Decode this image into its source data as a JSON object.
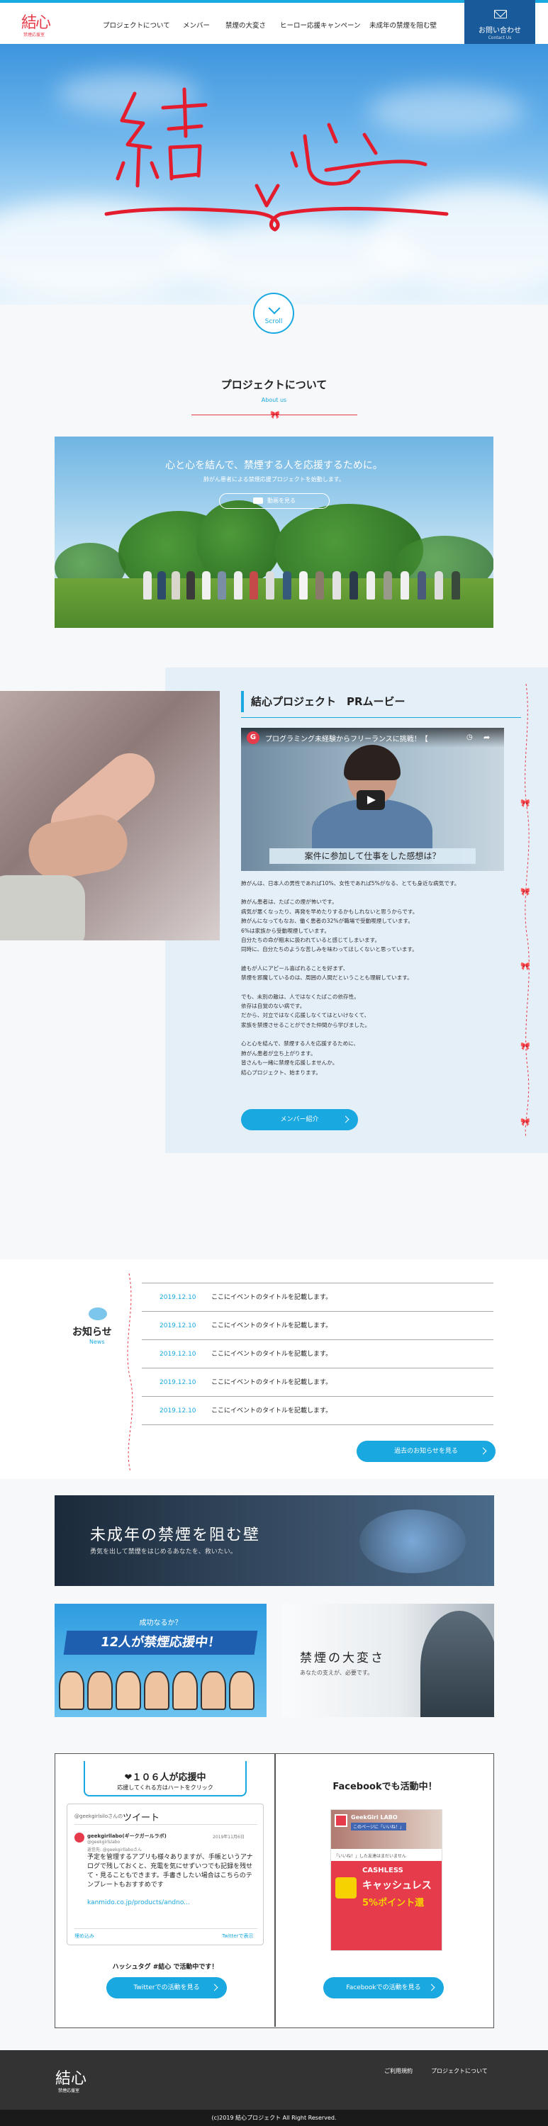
{
  "header": {
    "logo_text": "結心",
    "logo_sub": "禁煙応援室",
    "nav": [
      "プロジェクトについて",
      "メンバー",
      "禁煙の大変さ",
      "ヒーロー応援キャンペーン",
      "未成年の禁煙を阻む壁"
    ],
    "contact_label": "お問い合わせ",
    "contact_sub": "Contact Us"
  },
  "hero": {
    "title": "結心",
    "scroll_label": "Scroll"
  },
  "about": {
    "title": "プロジェクトについて",
    "subtitle": "About us",
    "banner_main": "心と心を結んで、禁煙する人を応援するために。",
    "banner_sub": "肺がん患者による禁煙応援プロジェクトを始動します。",
    "banner_button": "動画を見る"
  },
  "pr": {
    "title": "結心プロジェクト　PRムービー",
    "video_title": "プログラミング未経験からフリーランスに挑戦！【",
    "video_caption": "案件に参加して仕事をした感想は？",
    "paragraphs": [
      [
        "肺がんは、日本人の男性であれば10%、女性であれば5%がなる、とても身近な病気です。"
      ],
      [
        "肺がん患者は、たばこの煙が怖いです。",
        "病気が悪くなったり、再発を早めたりするかもしれないと思うからです。",
        "肺がんになってもなお、働く患者の32%が職場で受動喫煙しています。",
        "6%は家族から受動喫煙しています。",
        "自分たちの命が粗末に扱われていると感じてしまいます。",
        "同時に、自分たちのような苦しみを味わってほしくないと思っています。"
      ],
      [
        "誰もが人にアピール喜ばれることを好まず、",
        "禁煙を邪魔しているのは、周囲の人間だということも理解しています。"
      ],
      [
        "でも、未別の敵は、人ではなくたばこの依存性。",
        "依存は自覚のない病です。",
        "だから、対立ではなく応援しなくてはといけなくて、",
        "家族を禁煙させることができた仲間から学びました。"
      ],
      [
        "心と心を結んで、禁煙する人を応援するために、",
        "肺がん患者が立ち上がります。",
        "皆さんも一緒に禁煙を応援しませんか。",
        "結心プロジェクト、始まります。"
      ]
    ],
    "member_button": "メンバー紹介"
  },
  "news": {
    "title": "お知らせ",
    "subtitle": "News",
    "items": [
      {
        "date": "2019.12.10",
        "title": "ここにイベントのタイトルを記載します。"
      },
      {
        "date": "2019.12.10",
        "title": "ここにイベントのタイトルを記載します。"
      },
      {
        "date": "2019.12.10",
        "title": "ここにイベントのタイトルを記載します。"
      },
      {
        "date": "2019.12.10",
        "title": "ここにイベントのタイトルを記載します。"
      },
      {
        "date": "2019.12.10",
        "title": "ここにイベントのタイトルを記載します。"
      }
    ],
    "more_button": "過去のお知らせを見る"
  },
  "banners": {
    "minor_title": "未成年の禁煙を阻む壁",
    "minor_sub": "勇気を出して禁煙をはじめるあなたを、救いたい。",
    "hero_question": "成功なるか？",
    "hero_main": "12人が禁煙応援中！",
    "difficulty_title": "禁煙の大変さ",
    "difficulty_sub": "あなたの支えが、必要です。"
  },
  "social": {
    "twitter_count": "❤１０６人が応援中",
    "twitter_sub": "応援してくれる方はハートをクリック",
    "tweet_by": "@geekgirlsiloさんの",
    "tweet_label": "ツイート",
    "tweet_date": "2019年11月6日",
    "tweet_account": "geekgirllabo(ギークガールラボ)",
    "tweet_handle": "@geekgirlslabo",
    "tweet_reply": "返信先: @geekgirllaboさん",
    "tweet_body": "予定を管理するアプリも様々ありますが、手帳というアナログで残しておくと、充電を気にせずいつでも記録を残せて・見ることもできます。手書きしたい場合はこちらのテンプレートもおすすめです",
    "tweet_link": "kanmido.co.jp/products/andno...",
    "tweet_embed": "埋め込み",
    "tweet_view": "Twitterで表示",
    "hashtag": "ハッシュタグ #結心 で活動中です！",
    "twitter_button": "Twitterでの活動を見る",
    "facebook_title": "Facebookでも活動中！",
    "fb_page": "GeekGirl LABO",
    "fb_like": "このページに「いいね！」",
    "fb_first": "「いいね！」した友達はまだいません",
    "fb_banner1": "CASHLESS",
    "fb_banner2": "キャッシュレス",
    "fb_banner3": "5%ポイント還",
    "facebook_button": "Facebookでの活動を見る"
  },
  "footer": {
    "logo_text": "結心",
    "logo_sub": "禁煙応援室",
    "links": [
      "ご利用規約",
      "プロジェクトについて"
    ],
    "copyright": "(c)2019 結心プロジェクト All Right Reserved."
  },
  "colors": {
    "accent": "#19a8e0",
    "red": "#e63b4a",
    "navy": "#195a9a"
  }
}
